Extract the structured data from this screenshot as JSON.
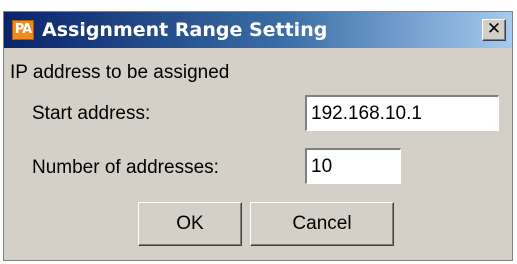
{
  "window": {
    "title": "Assignment Range Setting",
    "app_icon_text": "PA",
    "app_icon_color": "#f08a1e",
    "close_symbol": "✕"
  },
  "form": {
    "group_label": "IP address to be assigned",
    "start_address_label": "Start address:",
    "start_address_value": "192.168.10.1",
    "count_label": "Number of addresses:",
    "count_value": "10"
  },
  "buttons": {
    "ok_label": "OK",
    "cancel_label": "Cancel"
  }
}
